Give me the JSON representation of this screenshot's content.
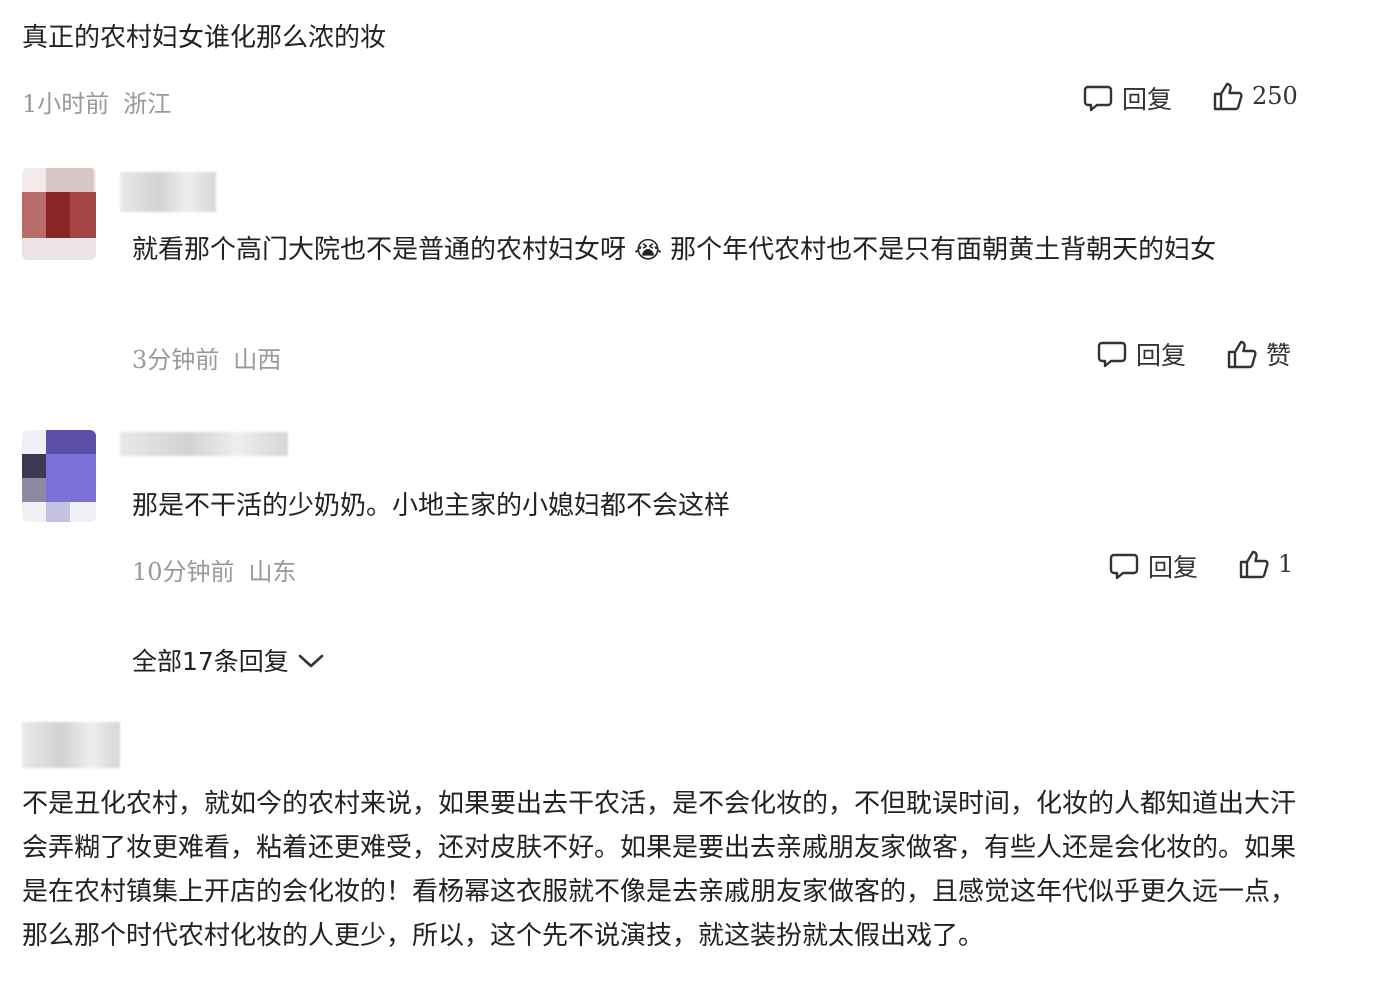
{
  "post": {
    "text": "真正的农村妇女谁化那么浓的妆",
    "time": "1小时前",
    "location": "浙江",
    "reply_label": "回复",
    "like_count": "250"
  },
  "replies": [
    {
      "text": "就看那个高门大院也不是普通的农村妇女呀",
      "emoji": "😭",
      "text2": "那个年代农村也不是只有面朝黄土背朝天的妇女",
      "time": "3分钟前",
      "location": "山西",
      "reply_label": "回复",
      "like_label": "赞"
    },
    {
      "text": "那是不干活的少奶奶。小地主家的小媳妇都不会这样",
      "time": "10分钟前",
      "location": "山东",
      "reply_label": "回复",
      "like_label": "1"
    }
  ],
  "expand": {
    "label": "全部17条回复"
  },
  "comment2": {
    "text": "不是丑化农村，就如今的农村来说，如果要出去干农活，是不会化妆的，不但耽误时间，化妆的人都知道出大汗会弄糊了妆更难看，粘着还更难受，还对皮肤不好。如果是要出去亲戚朋友家做客，有些人还是会化妆的。如果是在农村镇集上开店的会化妆的！看杨幂这衣服就不像是去亲戚朋友家做客的，且感觉这年代似乎更久远一点，那么那个时代农村化妆的人更少，所以，这个先不说演技，就这装扮就太假出戏了。"
  },
  "icons": {
    "reply": "comment-bubble-icon",
    "like": "thumbs-up-icon",
    "expand": "chevron-down-icon"
  },
  "colors": {
    "meta": "#999999",
    "text": "#222222"
  }
}
